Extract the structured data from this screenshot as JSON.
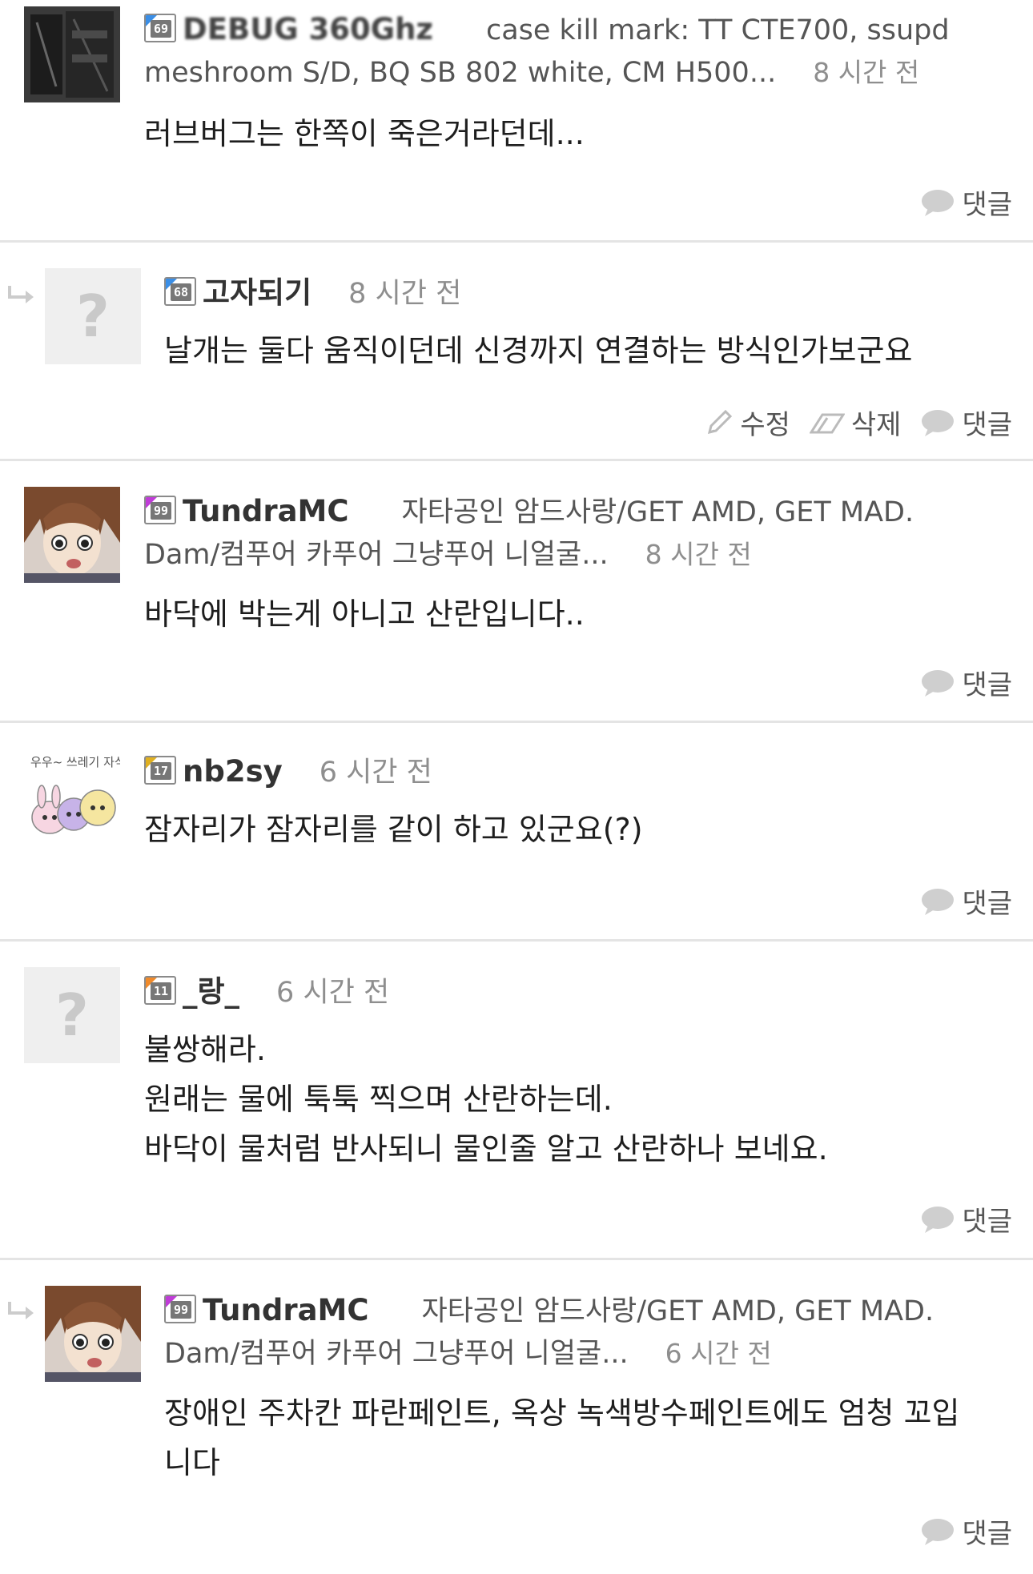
{
  "comments": [
    {
      "level": "69",
      "level_color": "#3a8ee6",
      "username": "DEBUG 360Ghz",
      "signature_line1": "case kill mark: TT CTE700, ssupd",
      "signature_line2": "meshroom S/D, BQ SB 802 white, CM H500...",
      "time": "8 시간 전",
      "body": [
        "러브버그는 한쪽이 죽은거라던데..."
      ],
      "reply_label": "댓글"
    },
    {
      "level": "68",
      "level_color": "#3a8ee6",
      "username": "고자되기",
      "time": "8 시간 전",
      "body": [
        "날개는 둘다 움직이던데 신경까지 연결하는 방식인가보군요"
      ],
      "edit_label": "수정",
      "delete_label": "삭제",
      "reply_label": "댓글",
      "avatar_placeholder": "?"
    },
    {
      "level": "99",
      "level_color": "#c03cd8",
      "username": "TundraMC",
      "signature_line1": "자타공인 암드사랑/GET AMD, GET MAD.",
      "signature_line2": "Dam/컴푸어 카푸어 그냥푸어 니얼굴...",
      "time": "8 시간 전",
      "body": [
        "바닥에 박는게 아니고 산란입니다.."
      ],
      "reply_label": "댓글"
    },
    {
      "level": "17",
      "level_color": "#e0b020",
      "username": "nb2sy",
      "time": "6 시간 전",
      "body": [
        "잠자리가 잠자리를 같이 하고 있군요(?)"
      ],
      "reply_label": "댓글",
      "avatar_text": "우우~ 쓰레기 자식~"
    },
    {
      "level": "11",
      "level_color": "#f08a2a",
      "username": "_랑_",
      "time": "6 시간 전",
      "body": [
        "불쌍해라.",
        "원래는 물에 툭툭 찍으며 산란하는데.",
        "바닥이 물처럼 반사되니 물인줄 알고 산란하나 보네요."
      ],
      "reply_label": "댓글",
      "avatar_placeholder": "?"
    },
    {
      "level": "99",
      "level_color": "#c03cd8",
      "username": "TundraMC",
      "signature_line1": "자타공인 암드사랑/GET AMD, GET MAD.",
      "signature_line2": "Dam/컴푸어 카푸어 그냥푸어 니얼굴...",
      "time": "6 시간 전",
      "body": [
        "장애인 주차칸 파란페인트, 옥상 녹색방수페인트에도 엄청 꼬입",
        "니다"
      ],
      "reply_label": "댓글"
    }
  ]
}
